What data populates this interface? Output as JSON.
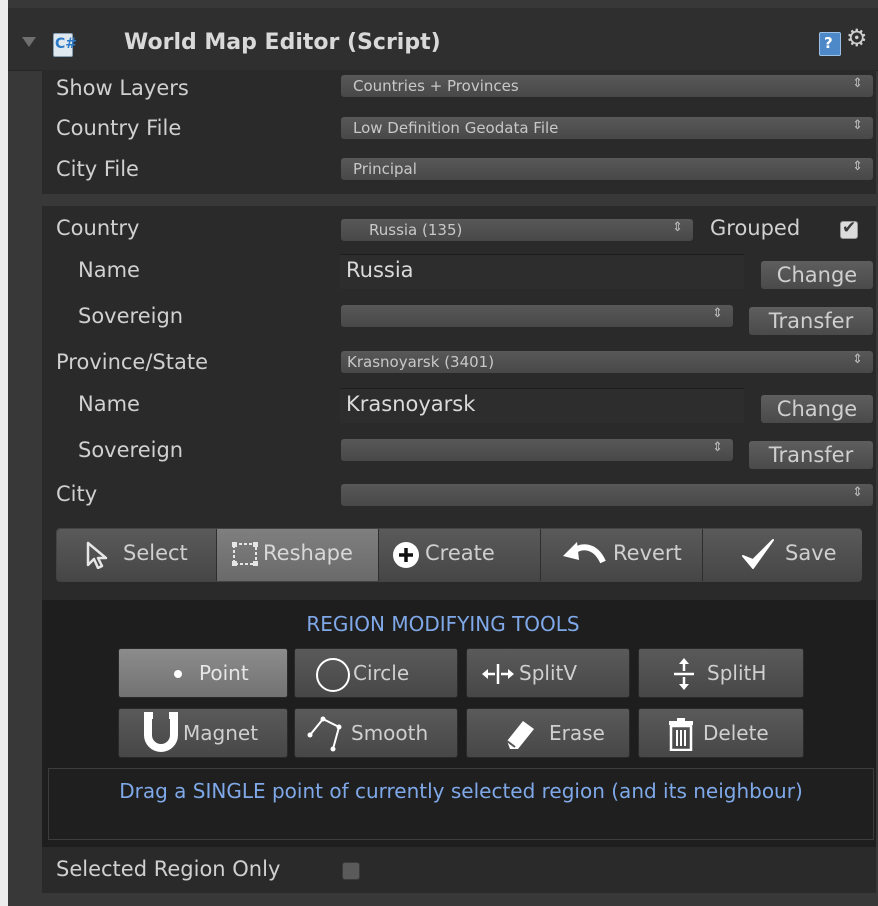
{
  "header": {
    "title": "World Map Editor (Script)",
    "script_icon_text": "C#",
    "help_icon_text": "?"
  },
  "settings": {
    "show_layers": {
      "label": "Show Layers",
      "value": "Countries + Provinces"
    },
    "country_file": {
      "label": "Country File",
      "value": "Low Definition Geodata File"
    },
    "city_file": {
      "label": "City File",
      "value": "Principal"
    }
  },
  "country": {
    "label": "Country",
    "value": "Russia (135)",
    "grouped_label": "Grouped",
    "grouped_checked": true,
    "name_label": "Name",
    "name_value": "Russia",
    "change_label": "Change",
    "sovereign_label": "Sovereign",
    "sovereign_value": "",
    "transfer_label": "Transfer"
  },
  "province": {
    "label": "Province/State",
    "value": "Krasnoyarsk (3401)",
    "name_label": "Name",
    "name_value": "Krasnoyarsk",
    "change_label": "Change",
    "sovereign_label": "Sovereign",
    "sovereign_value": "",
    "transfer_label": "Transfer"
  },
  "city": {
    "label": "City",
    "value": ""
  },
  "toolbar": {
    "select": "Select",
    "reshape": "Reshape",
    "create": "Create",
    "revert": "Revert",
    "save": "Save",
    "selected": "reshape"
  },
  "region_tools": {
    "title": "REGION MODIFYING TOOLS",
    "point": "Point",
    "circle": "Circle",
    "splitv": "SplitV",
    "splith": "SplitH",
    "magnet": "Magnet",
    "smooth": "Smooth",
    "erase": "Erase",
    "delete": "Delete",
    "selected": "point",
    "hint": "Drag a SINGLE point of currently selected region (and its neighbour)"
  },
  "selected_region_only": {
    "label": "Selected Region Only",
    "checked": false
  },
  "colors": {
    "panel": "#383838",
    "accent_text": "#7fa8e8",
    "selected_button": "#7a7a7a"
  }
}
